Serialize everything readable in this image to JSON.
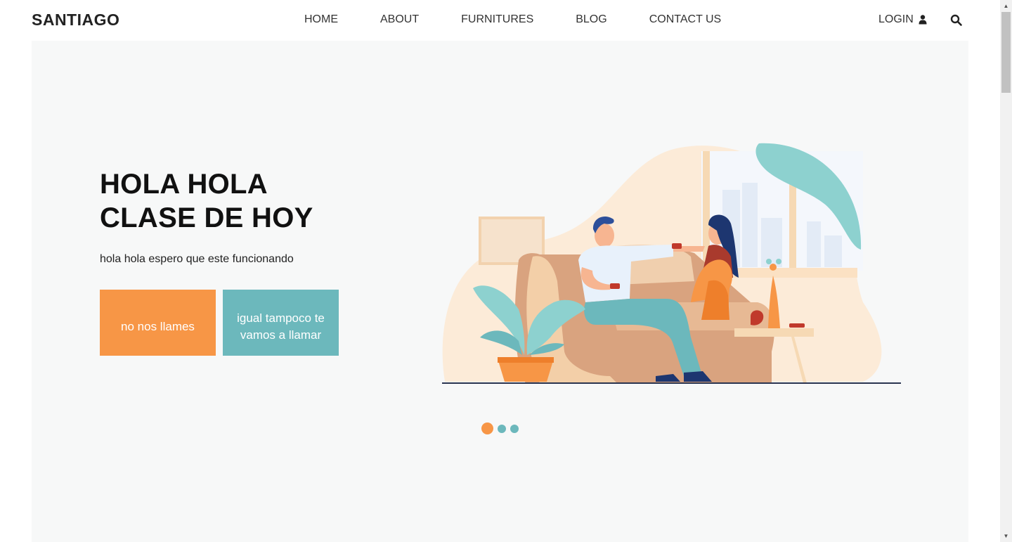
{
  "header": {
    "brand": "SANTIAGO",
    "nav": [
      "HOME",
      "ABOUT",
      "FURNITURES",
      "BLOG",
      "CONTACT US"
    ],
    "login_label": "LOGIN",
    "login_icon": "user-icon",
    "search_icon": "search-icon"
  },
  "hero": {
    "title_line1": "HOLA HOLA",
    "title_line2": "CLASE DE HOY",
    "subtitle": "hola hola espero que este funcionando",
    "button_primary": "no nos llames",
    "button_secondary": "igual tampoco te vamos a llamar",
    "image": "couple-sitting-on-sofa-illustration",
    "slider": {
      "count": 3,
      "active": 1
    }
  },
  "colors": {
    "accent_orange": "#f79646",
    "accent_teal": "#6cb8bc",
    "hero_bg": "#f7f8f8"
  }
}
